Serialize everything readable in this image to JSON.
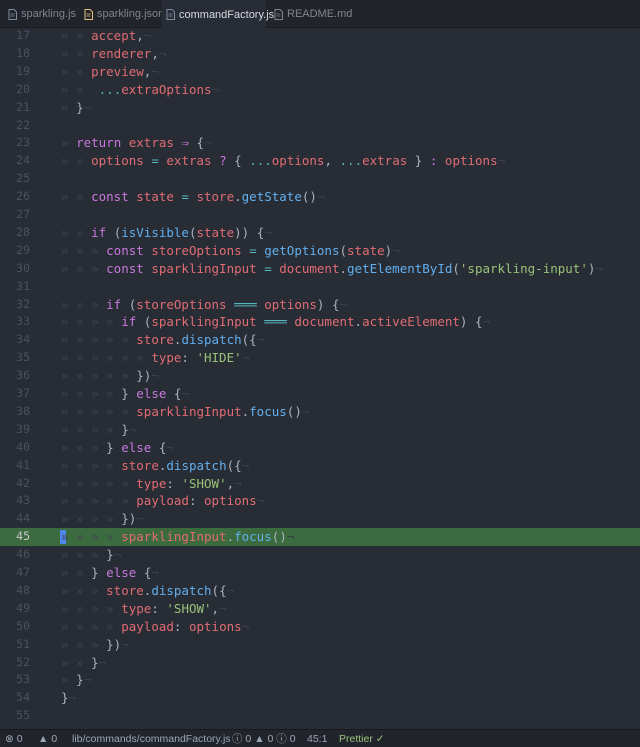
{
  "tabs": [
    {
      "label": "sparkling.js",
      "icon": "js-file-icon",
      "active": false
    },
    {
      "label": "sparkling.json",
      "icon": "json-file-icon",
      "active": false
    },
    {
      "label": "commandFactory.js",
      "icon": "js-file-icon",
      "active": true
    },
    {
      "label": "README.md",
      "icon": "markdown-file-icon",
      "active": false
    }
  ],
  "editor": {
    "active_line": 45,
    "lines": [
      {
        "n": "17",
        "indent": 2,
        "toks": [
          [
            "var",
            "accept"
          ],
          [
            "pn",
            ","
          ]
        ]
      },
      {
        "n": "18",
        "indent": 2,
        "toks": [
          [
            "var",
            "renderer"
          ],
          [
            "pn",
            ","
          ]
        ]
      },
      {
        "n": "19",
        "indent": 2,
        "toks": [
          [
            "var",
            "preview"
          ],
          [
            "pn",
            ","
          ]
        ]
      },
      {
        "n": "20",
        "indent": 2,
        "toks": [
          [
            "pn",
            " "
          ],
          [
            "op",
            "..."
          ],
          [
            "var",
            "extraOptions"
          ]
        ]
      },
      {
        "n": "21",
        "indent": 1,
        "toks": [
          [
            "pn",
            "}"
          ]
        ]
      },
      {
        "n": "22",
        "indent": 0,
        "toks": []
      },
      {
        "n": "23",
        "indent": 1,
        "toks": [
          [
            "kw",
            "return "
          ],
          [
            "var",
            "extras "
          ],
          [
            "kw",
            "⇒ "
          ],
          [
            "pn",
            "{"
          ]
        ]
      },
      {
        "n": "24",
        "indent": 2,
        "toks": [
          [
            "var",
            "options "
          ],
          [
            "op",
            "= "
          ],
          [
            "var",
            "extras "
          ],
          [
            "kw",
            "? "
          ],
          [
            "pn",
            "{ "
          ],
          [
            "op",
            "..."
          ],
          [
            "var",
            "options"
          ],
          [
            "pn",
            ", "
          ],
          [
            "op",
            "..."
          ],
          [
            "var",
            "extras "
          ],
          [
            "pn",
            "} "
          ],
          [
            "kw",
            ": "
          ],
          [
            "var",
            "options"
          ]
        ]
      },
      {
        "n": "25",
        "indent": 0,
        "toks": []
      },
      {
        "n": "26",
        "indent": 2,
        "toks": [
          [
            "kw",
            "const "
          ],
          [
            "var",
            "state "
          ],
          [
            "op",
            "= "
          ],
          [
            "var",
            "store"
          ],
          [
            "pn",
            "."
          ],
          [
            "fn",
            "getState"
          ],
          [
            "pn",
            "()"
          ]
        ]
      },
      {
        "n": "27",
        "indent": 0,
        "toks": []
      },
      {
        "n": "28",
        "indent": 2,
        "toks": [
          [
            "kw",
            "if "
          ],
          [
            "pn",
            "("
          ],
          [
            "fn",
            "isVisible"
          ],
          [
            "pn",
            "("
          ],
          [
            "var",
            "state"
          ],
          [
            "pn",
            ")) {"
          ]
        ]
      },
      {
        "n": "29",
        "indent": 3,
        "toks": [
          [
            "kw",
            "const "
          ],
          [
            "var",
            "storeOptions "
          ],
          [
            "op",
            "= "
          ],
          [
            "fn",
            "getOptions"
          ],
          [
            "pn",
            "("
          ],
          [
            "var",
            "state"
          ],
          [
            "pn",
            ")"
          ]
        ]
      },
      {
        "n": "30",
        "indent": 3,
        "toks": [
          [
            "kw",
            "const "
          ],
          [
            "var",
            "sparklingInput "
          ],
          [
            "op",
            "= "
          ],
          [
            "var",
            "document"
          ],
          [
            "pn",
            "."
          ],
          [
            "fn",
            "getElementById"
          ],
          [
            "pn",
            "("
          ],
          [
            "str",
            "'sparkling-input'"
          ],
          [
            "pn",
            ")"
          ]
        ]
      },
      {
        "n": "31",
        "indent": 0,
        "toks": []
      },
      {
        "n": "32",
        "indent": 3,
        "toks": [
          [
            "kw",
            "if "
          ],
          [
            "pn",
            "("
          ],
          [
            "var",
            "storeOptions "
          ],
          [
            "op",
            "═══ "
          ],
          [
            "var",
            "options"
          ],
          [
            "pn",
            ") {"
          ]
        ]
      },
      {
        "n": "33",
        "indent": 4,
        "toks": [
          [
            "kw",
            "if "
          ],
          [
            "pn",
            "("
          ],
          [
            "var",
            "sparklingInput "
          ],
          [
            "op",
            "═══ "
          ],
          [
            "var",
            "document"
          ],
          [
            "pn",
            "."
          ],
          [
            "var",
            "activeElement"
          ],
          [
            "pn",
            ") {"
          ]
        ]
      },
      {
        "n": "34",
        "indent": 5,
        "toks": [
          [
            "var",
            "store"
          ],
          [
            "pn",
            "."
          ],
          [
            "fn",
            "dispatch"
          ],
          [
            "pn",
            "({"
          ]
        ]
      },
      {
        "n": "35",
        "indent": 6,
        "toks": [
          [
            "var",
            "type"
          ],
          [
            "pn",
            ": "
          ],
          [
            "str",
            "'HIDE'"
          ]
        ]
      },
      {
        "n": "36",
        "indent": 5,
        "toks": [
          [
            "pn",
            "})"
          ]
        ]
      },
      {
        "n": "37",
        "indent": 4,
        "toks": [
          [
            "pn",
            "} "
          ],
          [
            "kw",
            "else "
          ],
          [
            "pn",
            "{"
          ]
        ]
      },
      {
        "n": "38",
        "indent": 5,
        "toks": [
          [
            "var",
            "sparklingInput"
          ],
          [
            "pn",
            "."
          ],
          [
            "fn",
            "focus"
          ],
          [
            "pn",
            "()"
          ]
        ]
      },
      {
        "n": "39",
        "indent": 4,
        "toks": [
          [
            "pn",
            "}"
          ]
        ]
      },
      {
        "n": "40",
        "indent": 3,
        "toks": [
          [
            "pn",
            "} "
          ],
          [
            "kw",
            "else "
          ],
          [
            "pn",
            "{"
          ]
        ]
      },
      {
        "n": "41",
        "indent": 4,
        "toks": [
          [
            "var",
            "store"
          ],
          [
            "pn",
            "."
          ],
          [
            "fn",
            "dispatch"
          ],
          [
            "pn",
            "({"
          ]
        ]
      },
      {
        "n": "42",
        "indent": 5,
        "toks": [
          [
            "var",
            "type"
          ],
          [
            "pn",
            ": "
          ],
          [
            "str",
            "'SHOW'"
          ],
          [
            "pn",
            ","
          ]
        ]
      },
      {
        "n": "43",
        "indent": 5,
        "toks": [
          [
            "var",
            "payload"
          ],
          [
            "pn",
            ": "
          ],
          [
            "var",
            "options"
          ]
        ]
      },
      {
        "n": "44",
        "indent": 4,
        "toks": [
          [
            "pn",
            "})"
          ]
        ]
      },
      {
        "n": "45",
        "indent": 4,
        "toks": [
          [
            "var",
            "sparklingInput"
          ],
          [
            "pn",
            "."
          ],
          [
            "fn",
            "focus"
          ],
          [
            "pn",
            "()"
          ]
        ]
      },
      {
        "n": "46",
        "indent": 3,
        "toks": [
          [
            "pn",
            "}"
          ]
        ]
      },
      {
        "n": "47",
        "indent": 2,
        "toks": [
          [
            "pn",
            "} "
          ],
          [
            "kw",
            "else "
          ],
          [
            "pn",
            "{"
          ]
        ]
      },
      {
        "n": "48",
        "indent": 3,
        "toks": [
          [
            "var",
            "store"
          ],
          [
            "pn",
            "."
          ],
          [
            "fn",
            "dispatch"
          ],
          [
            "pn",
            "({"
          ]
        ]
      },
      {
        "n": "49",
        "indent": 4,
        "toks": [
          [
            "var",
            "type"
          ],
          [
            "pn",
            ": "
          ],
          [
            "str",
            "'SHOW'"
          ],
          [
            "pn",
            ","
          ]
        ]
      },
      {
        "n": "50",
        "indent": 4,
        "toks": [
          [
            "var",
            "payload"
          ],
          [
            "pn",
            ": "
          ],
          [
            "var",
            "options"
          ]
        ]
      },
      {
        "n": "51",
        "indent": 3,
        "toks": [
          [
            "pn",
            "})"
          ]
        ]
      },
      {
        "n": "52",
        "indent": 2,
        "toks": [
          [
            "pn",
            "}"
          ]
        ]
      },
      {
        "n": "53",
        "indent": 1,
        "toks": [
          [
            "pn",
            "}"
          ]
        ]
      },
      {
        "n": "54",
        "indent": 0,
        "toks": [
          [
            "pn",
            "}"
          ]
        ]
      },
      {
        "n": "55",
        "indent": 0,
        "toks": []
      }
    ]
  },
  "status": {
    "errors": "0",
    "warnings": "0",
    "path": "lib/commands/commandFactory.js",
    "lint_errors": "0",
    "lint_warnings": "0",
    "lint_info": "0",
    "cursor": "45:1",
    "formatter": "Prettier",
    "formatter_check": "✓"
  },
  "colors": {
    "background": "#282c34",
    "active_line": "#3d6b40",
    "keyword": "#c678dd",
    "variable": "#e06c75",
    "function": "#61afef",
    "string": "#98c379",
    "operator": "#56b6c2"
  }
}
